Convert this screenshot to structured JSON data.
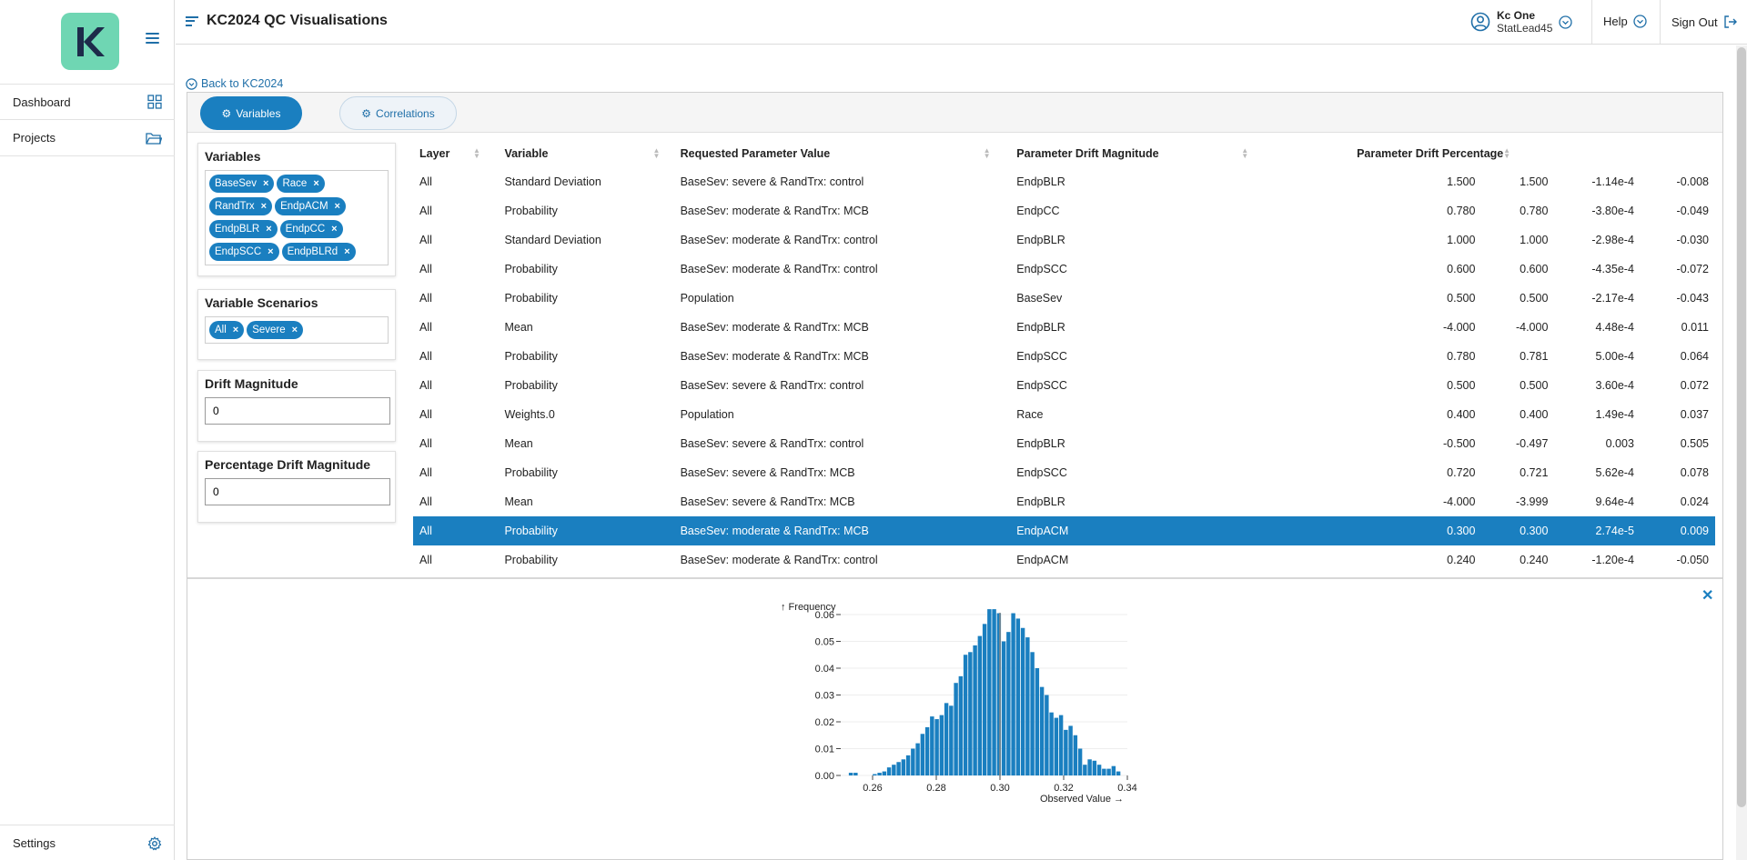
{
  "sidebar": {
    "logo_letter": "K",
    "items": [
      {
        "label": "Dashboard",
        "icon": "grid-icon"
      },
      {
        "label": "Projects",
        "icon": "folder-icon"
      }
    ],
    "settings_label": "Settings"
  },
  "header": {
    "title": "KC2024 QC Visualisations",
    "user_name": "Kc One",
    "user_role": "StatLead45",
    "help_label": "Help",
    "signout_label": "Sign Out"
  },
  "back_link": "Back to KC2024",
  "tabs": [
    {
      "label": "Variables",
      "active": true
    },
    {
      "label": "Correlations",
      "active": false
    }
  ],
  "filters": {
    "variables": {
      "title": "Variables",
      "chips": [
        "BaseSev",
        "Race",
        "RandTrx",
        "EndpACM",
        "EndpBLR",
        "EndpCC",
        "EndpSCC",
        "EndpBLRd"
      ]
    },
    "scenarios": {
      "title": "Variable Scenarios",
      "chips": [
        "All",
        "Severe"
      ]
    },
    "drift_magnitude": {
      "title": "Drift Magnitude",
      "value": "0"
    },
    "percentage_drift": {
      "title": "Percentage Drift Magnitude",
      "value": "0"
    }
  },
  "table": {
    "headers": [
      "Layer",
      "Variable",
      "Requested Parameter Value",
      "Parameter Drift Magnitude",
      "Parameter Drift Percentage"
    ],
    "rows": [
      [
        "All",
        "Standard Deviation",
        "BaseSev: severe & RandTrx: control",
        "EndpBLR",
        "1.500",
        "1.500",
        "-1.14e-4",
        "-0.008"
      ],
      [
        "All",
        "Probability",
        "BaseSev: moderate & RandTrx: MCB",
        "EndpCC",
        "0.780",
        "0.780",
        "-3.80e-4",
        "-0.049"
      ],
      [
        "All",
        "Standard Deviation",
        "BaseSev: moderate & RandTrx: control",
        "EndpBLR",
        "1.000",
        "1.000",
        "-2.98e-4",
        "-0.030"
      ],
      [
        "All",
        "Probability",
        "BaseSev: moderate & RandTrx: control",
        "EndpSCC",
        "0.600",
        "0.600",
        "-4.35e-4",
        "-0.072"
      ],
      [
        "All",
        "Probability",
        "Population",
        "BaseSev",
        "0.500",
        "0.500",
        "-2.17e-4",
        "-0.043"
      ],
      [
        "All",
        "Mean",
        "BaseSev: moderate & RandTrx: MCB",
        "EndpBLR",
        "-4.000",
        "-4.000",
        "4.48e-4",
        "0.011"
      ],
      [
        "All",
        "Probability",
        "BaseSev: moderate & RandTrx: MCB",
        "EndpSCC",
        "0.780",
        "0.781",
        "5.00e-4",
        "0.064"
      ],
      [
        "All",
        "Probability",
        "BaseSev: severe & RandTrx: control",
        "EndpSCC",
        "0.500",
        "0.500",
        "3.60e-4",
        "0.072"
      ],
      [
        "All",
        "Weights.0",
        "Population",
        "Race",
        "0.400",
        "0.400",
        "1.49e-4",
        "0.037"
      ],
      [
        "All",
        "Mean",
        "BaseSev: severe & RandTrx: control",
        "EndpBLR",
        "-0.500",
        "-0.497",
        "0.003",
        "0.505"
      ],
      [
        "All",
        "Probability",
        "BaseSev: severe & RandTrx: MCB",
        "EndpSCC",
        "0.720",
        "0.721",
        "5.62e-4",
        "0.078"
      ],
      [
        "All",
        "Mean",
        "BaseSev: severe & RandTrx: MCB",
        "EndpBLR",
        "-4.000",
        "-3.999",
        "9.64e-4",
        "0.024"
      ],
      [
        "All",
        "Probability",
        "BaseSev: moderate & RandTrx: MCB",
        "EndpACM",
        "0.300",
        "0.300",
        "2.74e-5",
        "0.009"
      ],
      [
        "All",
        "Probability",
        "BaseSev: moderate & RandTrx: control",
        "EndpACM",
        "0.240",
        "0.240",
        "-1.20e-4",
        "-0.050"
      ]
    ],
    "selected_row": 12
  },
  "colors": {
    "accent": "#1a7fc0",
    "logo_bg": "#6fd6b3",
    "logo_fg": "#1d2b4a",
    "bar": "#1a7fc0",
    "ref_line": "#888888"
  },
  "chart_data": {
    "type": "bar",
    "ylabel": "↑ Frequency",
    "xlabel": "Observed Value →",
    "xlim": [
      0.25,
      0.34
    ],
    "ylim": [
      0,
      0.06
    ],
    "x_ticks": [
      "0.26",
      "0.28",
      "0.30",
      "0.32",
      "0.34"
    ],
    "y_ticks": [
      "0.00",
      "0.01",
      "0.02",
      "0.03",
      "0.04",
      "0.05",
      "0.06"
    ],
    "reference_value": 0.3,
    "bin_width": 0.0015,
    "bins": [
      {
        "x": 0.2532,
        "y": 0.001
      },
      {
        "x": 0.2547,
        "y": 0.001
      },
      {
        "x": 0.2607,
        "y": 0.0005
      },
      {
        "x": 0.2622,
        "y": 0.001
      },
      {
        "x": 0.2637,
        "y": 0.0015
      },
      {
        "x": 0.2652,
        "y": 0.003
      },
      {
        "x": 0.2667,
        "y": 0.004
      },
      {
        "x": 0.2682,
        "y": 0.005
      },
      {
        "x": 0.2697,
        "y": 0.006
      },
      {
        "x": 0.2712,
        "y": 0.0075
      },
      {
        "x": 0.2727,
        "y": 0.01
      },
      {
        "x": 0.2742,
        "y": 0.012
      },
      {
        "x": 0.2757,
        "y": 0.0155
      },
      {
        "x": 0.2772,
        "y": 0.018
      },
      {
        "x": 0.2787,
        "y": 0.022
      },
      {
        "x": 0.2802,
        "y": 0.021
      },
      {
        "x": 0.2817,
        "y": 0.0225
      },
      {
        "x": 0.2832,
        "y": 0.027
      },
      {
        "x": 0.2847,
        "y": 0.026
      },
      {
        "x": 0.2862,
        "y": 0.0345
      },
      {
        "x": 0.2877,
        "y": 0.037
      },
      {
        "x": 0.2892,
        "y": 0.045
      },
      {
        "x": 0.2907,
        "y": 0.046
      },
      {
        "x": 0.2922,
        "y": 0.0485
      },
      {
        "x": 0.2937,
        "y": 0.052
      },
      {
        "x": 0.2952,
        "y": 0.0565
      },
      {
        "x": 0.2967,
        "y": 0.062
      },
      {
        "x": 0.2982,
        "y": 0.062
      },
      {
        "x": 0.2997,
        "y": 0.0605
      },
      {
        "x": 0.3012,
        "y": 0.05
      },
      {
        "x": 0.3027,
        "y": 0.0535
      },
      {
        "x": 0.3042,
        "y": 0.0605
      },
      {
        "x": 0.3057,
        "y": 0.0585
      },
      {
        "x": 0.3072,
        "y": 0.055
      },
      {
        "x": 0.3087,
        "y": 0.0515
      },
      {
        "x": 0.3102,
        "y": 0.046
      },
      {
        "x": 0.3117,
        "y": 0.04
      },
      {
        "x": 0.3132,
        "y": 0.033
      },
      {
        "x": 0.3147,
        "y": 0.03
      },
      {
        "x": 0.3162,
        "y": 0.0235
      },
      {
        "x": 0.3177,
        "y": 0.0215
      },
      {
        "x": 0.3192,
        "y": 0.0225
      },
      {
        "x": 0.3207,
        "y": 0.017
      },
      {
        "x": 0.3222,
        "y": 0.0185
      },
      {
        "x": 0.3237,
        "y": 0.015
      },
      {
        "x": 0.3252,
        "y": 0.01
      },
      {
        "x": 0.3267,
        "y": 0.004
      },
      {
        "x": 0.3282,
        "y": 0.006
      },
      {
        "x": 0.3297,
        "y": 0.0055
      },
      {
        "x": 0.3312,
        "y": 0.004
      },
      {
        "x": 0.3327,
        "y": 0.0025
      },
      {
        "x": 0.3342,
        "y": 0.0025
      },
      {
        "x": 0.3357,
        "y": 0.0035
      },
      {
        "x": 0.3372,
        "y": 0.0015
      }
    ]
  }
}
